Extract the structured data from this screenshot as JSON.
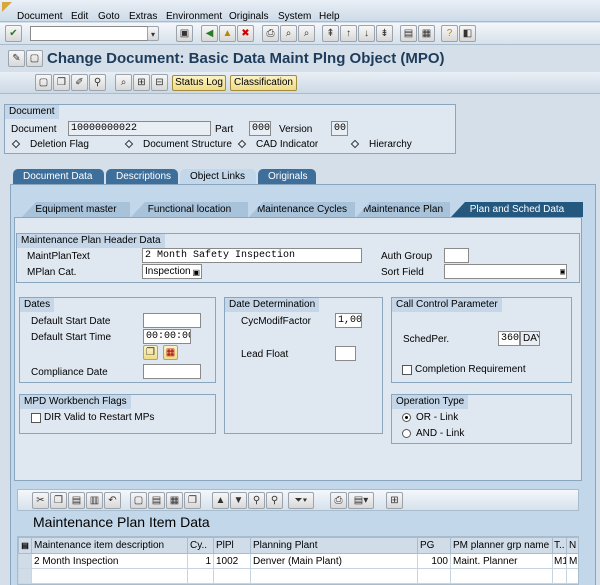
{
  "menu": [
    "Document",
    "Edit",
    "Goto",
    "Extras",
    "Environment",
    "Originals",
    "System",
    "Help"
  ],
  "title": "Change Document: Basic Data Maint Plng Object (MPO)",
  "app_toolbar": {
    "status_log": "Status Log",
    "classification": "Classification"
  },
  "document_group": {
    "title": "Document",
    "document_label": "Document",
    "document_value": "10000000022",
    "part_label": "Part",
    "part_value": "000",
    "version_label": "Version",
    "version_value": "00",
    "flags": [
      "Deletion Flag",
      "Document Structure",
      "CAD Indicator",
      "Hierarchy"
    ]
  },
  "main_tabs": [
    "Document Data",
    "Descriptions",
    "Object Links",
    "Originals"
  ],
  "main_tab_active": "Object Links",
  "sub_tabs": [
    "Equipment master",
    "Functional location",
    "Maintenance Cycles",
    "Maintenance Plan",
    "Plan and Sched Data"
  ],
  "sub_tab_active": "Plan and Sched Data",
  "header": {
    "title": "Maintenance Plan Header Data",
    "maintplantext_label": "MaintPlanText",
    "maintplantext_value": "2 Month Safety Inspection",
    "mplan_cat_label": "MPlan Cat.",
    "mplan_cat_value": "Inspection",
    "auth_group_label": "Auth Group",
    "auth_group_value": "",
    "sort_field_label": "Sort Field",
    "sort_field_value": ""
  },
  "dates": {
    "title": "Dates",
    "default_start_date_label": "Default Start Date",
    "default_start_date_value": "",
    "default_start_time_label": "Default Start Time",
    "default_start_time_value": "00:00:00",
    "compliance_date_label": "Compliance Date",
    "compliance_date_value": ""
  },
  "date_determination": {
    "title": "Date Determination",
    "cycmodif_label": "CycModifFactor",
    "cycmodif_value": "1,00",
    "lead_float_label": "Lead Float",
    "lead_float_value": ""
  },
  "call_control": {
    "title": "Call Control Parameter",
    "schedper_label": "SchedPer.",
    "schedper_value": "360",
    "schedper_unit": "DAY",
    "completion_label": "Completion Requirement"
  },
  "workbench": {
    "title": "MPD Workbench Flags",
    "dir_label": "DIR Valid to Restart MPs"
  },
  "operation_type": {
    "title": "Operation Type",
    "or_label": "OR - Link",
    "and_label": "AND - Link"
  },
  "item_data": {
    "title": "Maintenance Plan Item Data",
    "columns": [
      "Maintenance item description",
      "Cy..",
      "PlPl",
      "Planning Plant",
      "PG",
      "PM planner grp name",
      "T..",
      "N"
    ],
    "rows": [
      [
        "2 Month Inspection",
        "1",
        "1002",
        "Denver (Main Plant)",
        "100",
        "Maint. Planner",
        "M1",
        "M"
      ]
    ]
  }
}
